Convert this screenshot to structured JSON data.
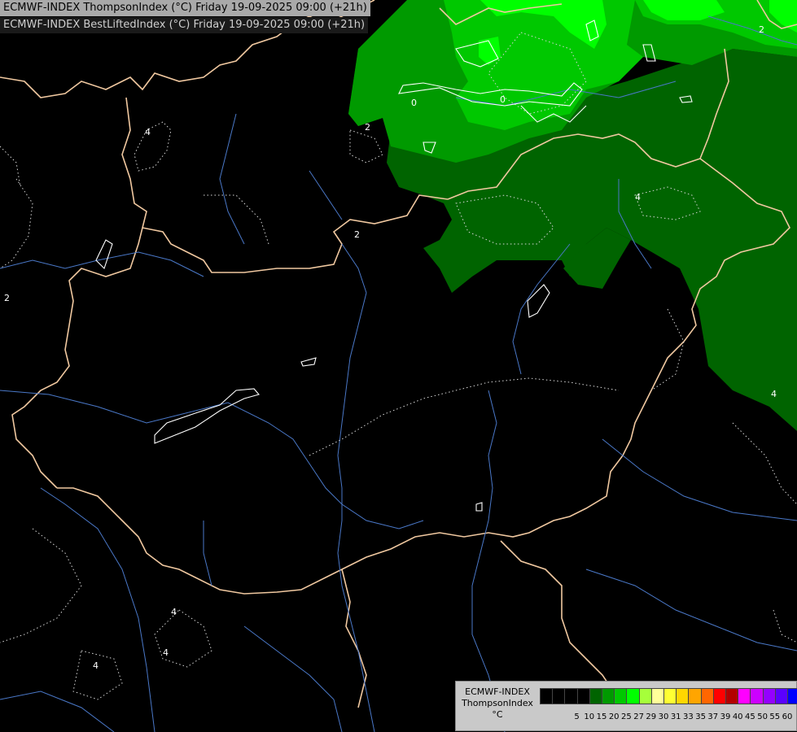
{
  "header": {
    "title_line1": "ECMWF-INDEX ThompsonIndex (°C) Friday 19-09-2025 09:00 (+21h)",
    "title_line2": "ECMWF-INDEX BestLiftedIndex (°C) Friday 19-09-2025 09:00 (+21h)"
  },
  "map": {
    "contour_labels": [
      "0",
      "0",
      "2",
      "2",
      "2",
      "4",
      "4",
      "4",
      "4",
      "4",
      "4",
      "2"
    ]
  },
  "legend": {
    "line1": "ECMWF-INDEX",
    "line2": "ThompsonIndex",
    "line3": "°C",
    "colors": [
      "#000000",
      "#000000",
      "#000000",
      "#000000",
      "#006400",
      "#009a00",
      "#00c800",
      "#00ff00",
      "#a6ff3a",
      "#ffff99",
      "#ffff33",
      "#ffd700",
      "#ffa500",
      "#ff6600",
      "#ff0000",
      "#b30000",
      "#ff00ff",
      "#cc00ff",
      "#9400ff",
      "#5a00ff",
      "#0000ff"
    ],
    "ticks": [
      "5",
      "10",
      "15",
      "20",
      "25",
      "27",
      "29",
      "30",
      "31",
      "33",
      "35",
      "37",
      "39",
      "40",
      "45",
      "50",
      "55",
      "60"
    ]
  }
}
